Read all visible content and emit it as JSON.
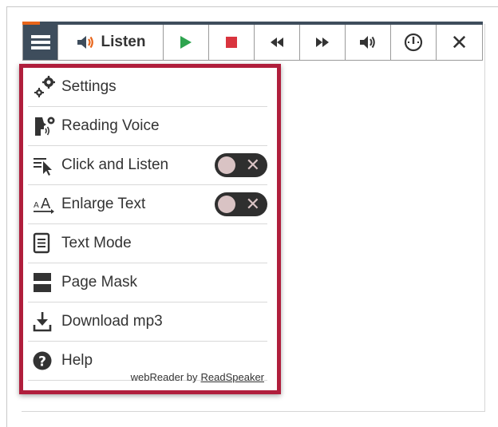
{
  "toolbar": {
    "listen_label": "Listen",
    "buttons": [
      "menu",
      "listen",
      "play",
      "stop",
      "rewind",
      "fast-forward",
      "volume",
      "speed",
      "close"
    ],
    "close_glyph": "✕",
    "colors": {
      "menu_bg": "#3e4d5c",
      "accent": "#e8651a",
      "play": "#2ea44f",
      "stop": "#d9343e"
    }
  },
  "menu": {
    "items": [
      {
        "label": "Settings",
        "icon": "settings-gears-icon"
      },
      {
        "label": "Reading Voice",
        "icon": "reading-voice-icon"
      },
      {
        "label": "Click and Listen",
        "icon": "click-and-listen-icon",
        "toggle": "off"
      },
      {
        "label": "Enlarge Text",
        "icon": "enlarge-text-icon",
        "toggle": "off"
      },
      {
        "label": "Text Mode",
        "icon": "text-mode-icon"
      },
      {
        "label": "Page Mask",
        "icon": "page-mask-icon"
      },
      {
        "label": "Download mp3",
        "icon": "download-icon"
      },
      {
        "label": "Help",
        "icon": "help-icon"
      }
    ],
    "toggle_off_glyph": "✕",
    "footer_text": "webReader by",
    "footer_link": "ReadSpeaker",
    "border_color": "#b01e3c"
  }
}
